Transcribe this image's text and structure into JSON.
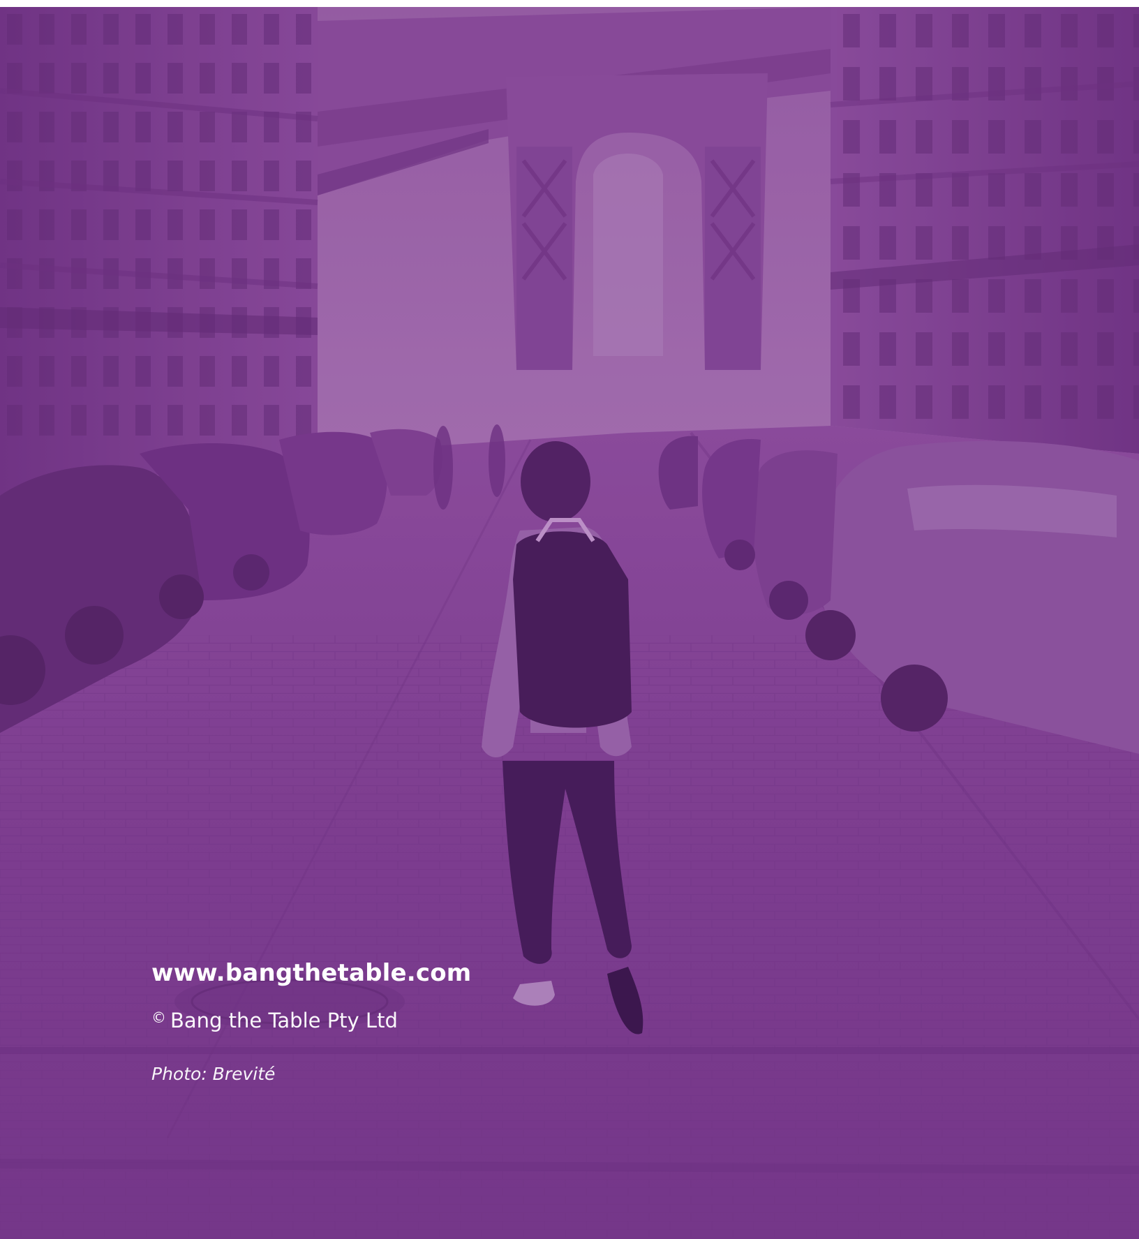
{
  "footer": {
    "website": "www.bangthetable.com",
    "copyright_symbol": "©",
    "copyright_text": "Bang the Table Pty Ltd",
    "photo_credit": "Photo: Brevité"
  },
  "colors": {
    "overlay": "#7b3a8d",
    "text": "#ffffff"
  }
}
